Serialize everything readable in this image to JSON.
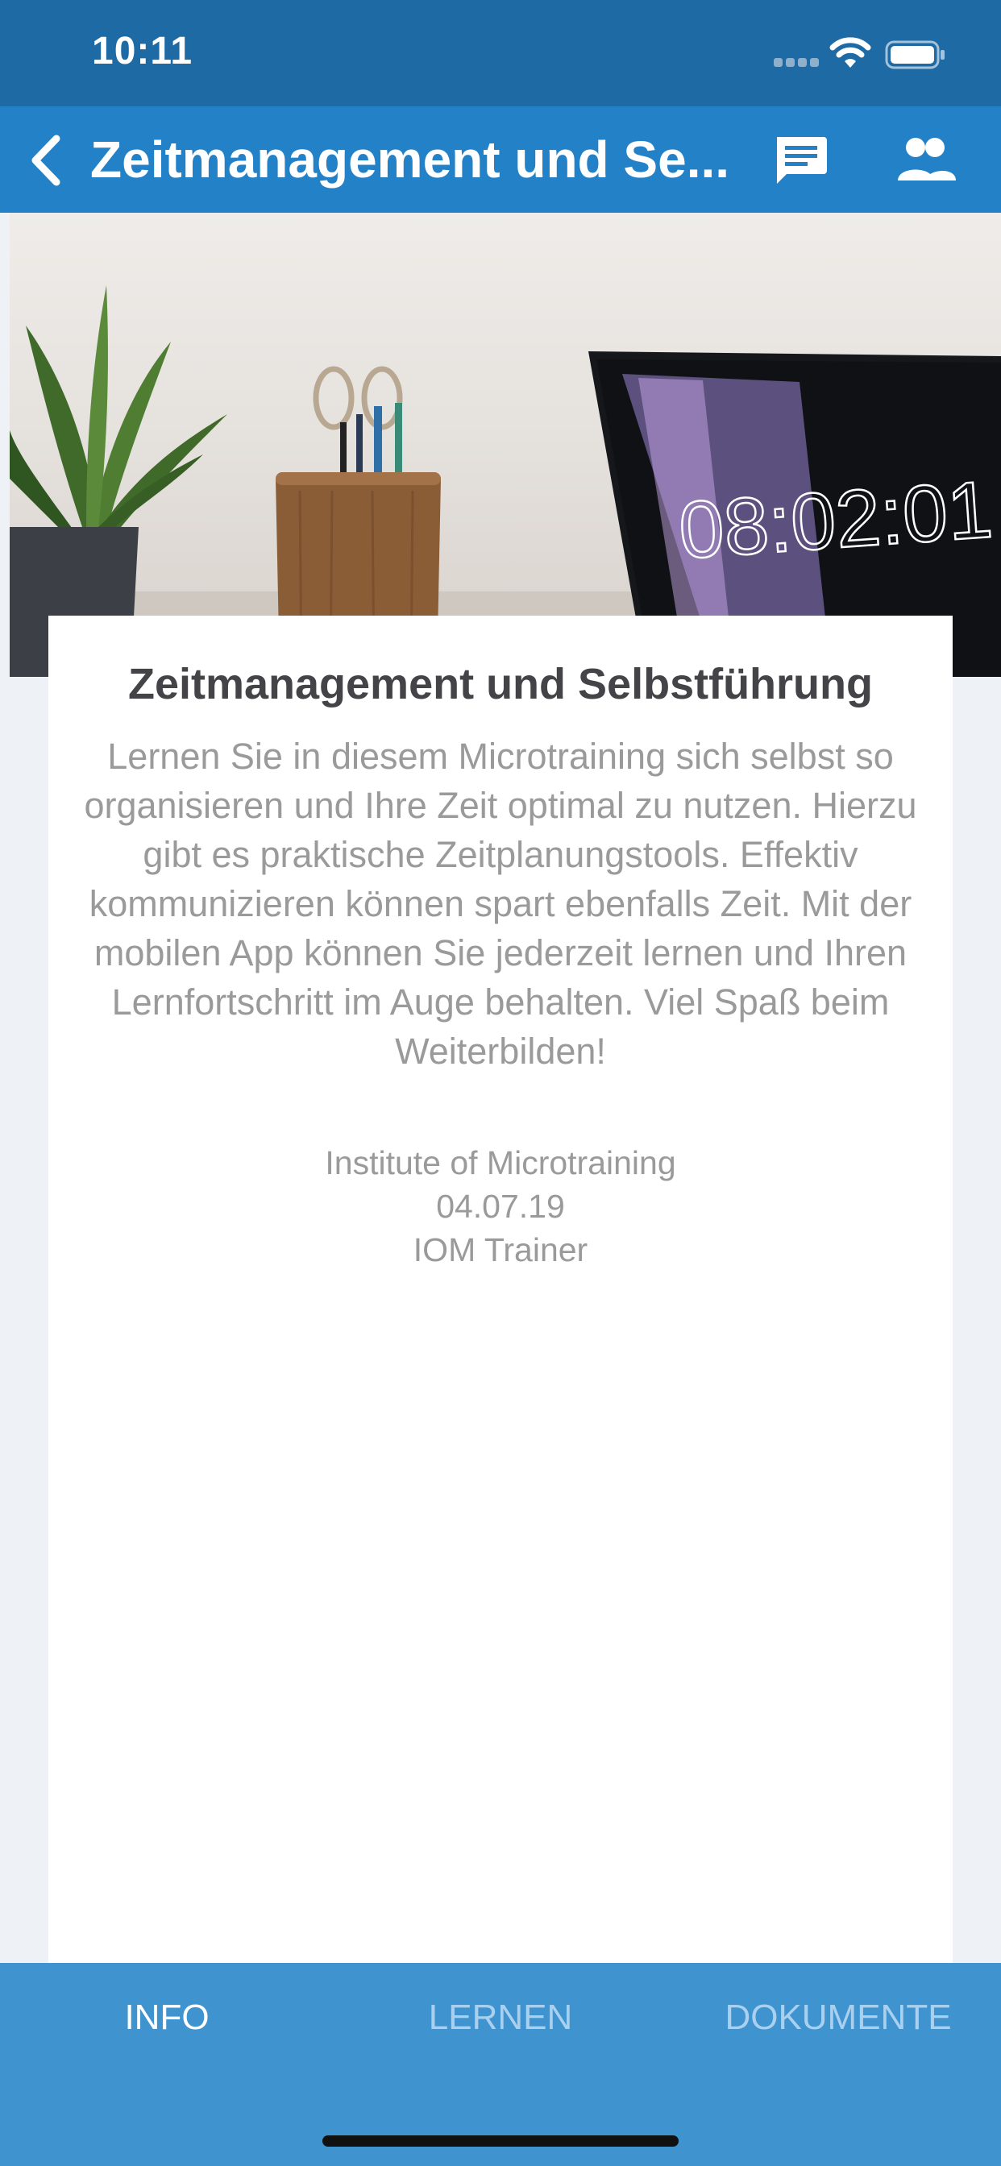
{
  "status_bar": {
    "time": "10:11"
  },
  "nav": {
    "title": "Zeitmanagement und Se...",
    "back_icon": "chevron-left-icon",
    "chat_icon": "chat-icon",
    "people_icon": "people-icon"
  },
  "hero": {
    "clock_text": "08:02:01"
  },
  "card": {
    "title": "Zeitmanagement und Selbstführung",
    "description": "Lernen Sie in diesem Microtraining sich selbst so organisieren und Ihre Zeit optimal zu nutzen. Hierzu gibt es praktische Zeitplanungstools. Effektiv kommunizieren können spart ebenfalls Zeit. Mit der mobilen App können Sie jederzeit lernen und Ihren Lernfortschritt im Auge behalten. Viel Spaß beim Weiterbilden!",
    "meta": {
      "organization": "Institute of Microtraining",
      "date": "04.07.19",
      "author": "IOM Trainer"
    }
  },
  "tabs": [
    {
      "label": "INFO",
      "active": true
    },
    {
      "label": "LERNEN",
      "active": false
    },
    {
      "label": "DOKUMENTE",
      "active": false
    }
  ],
  "colors": {
    "status_bar": "#1d6aa4",
    "nav_bar": "#2381c7",
    "tab_bar": "#3f93cf",
    "background": "#eef2f6"
  }
}
